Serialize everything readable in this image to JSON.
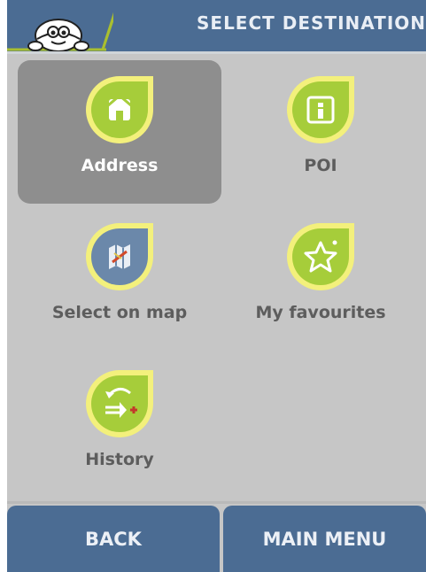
{
  "header": {
    "title": "SELECT DESTINATION",
    "logo_icon": "michelin-man-logo-icon"
  },
  "tiles": [
    {
      "label": "Address",
      "icon": "house-icon",
      "selected": true
    },
    {
      "label": "POI",
      "icon": "info-icon",
      "selected": false
    },
    {
      "label": "Select on map",
      "icon": "map-icon",
      "selected": false
    },
    {
      "label": "My favourites",
      "icon": "star-icon",
      "selected": false
    },
    {
      "label": "History",
      "icon": "history-arrows-icon",
      "selected": false
    }
  ],
  "buttons": {
    "back_label": "BACK",
    "main_menu_label": "MAIN MENU"
  },
  "colors": {
    "header_bg": "#4b6c93",
    "screen_bg": "#c6c6c6",
    "selected_tile_bg": "#8e8e8e",
    "icon_green": "#a8cf3a",
    "icon_ring": "#f2f07a"
  }
}
